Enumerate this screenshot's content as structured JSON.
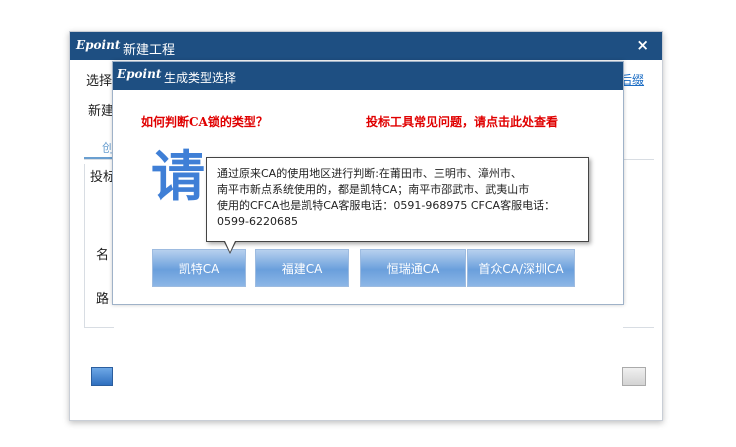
{
  "outer_dialog": {
    "logo": "Epoint",
    "title": "新建工程",
    "close": "×",
    "label_select": "选择",
    "label_new": "新建",
    "label_tab": "创",
    "label_bid": "投标",
    "label_name": "名",
    "label_path": "路",
    "help_link": "后缀"
  },
  "inner_dialog": {
    "logo": "Epoint",
    "title": "生成类型选择",
    "link_ca_type": "如何判断CA锁的类型？",
    "link_faq": "投标工具常见问题，请点击此处查看",
    "big_char": "请",
    "ca_buttons": [
      "凯特CA",
      "福建CA",
      "恒瑞通CA",
      "首众CA/深圳CA"
    ]
  },
  "tooltip": {
    "line1": "通过原来CA的使用地区进行判断:在莆田市、三明市、漳州市、",
    "line2": "南平市新点系统使用的，都是凯特CA；南平市邵武市、武夷山市",
    "line3": "使用的CFCA也是凯特CA客服电话：0591-968975 CFCA客服电话：",
    "line4": "0599-6220685"
  },
  "colors": {
    "titlebar": "#1e4f82",
    "red_link": "#e00000",
    "ca_button": "#6a9fdc"
  }
}
